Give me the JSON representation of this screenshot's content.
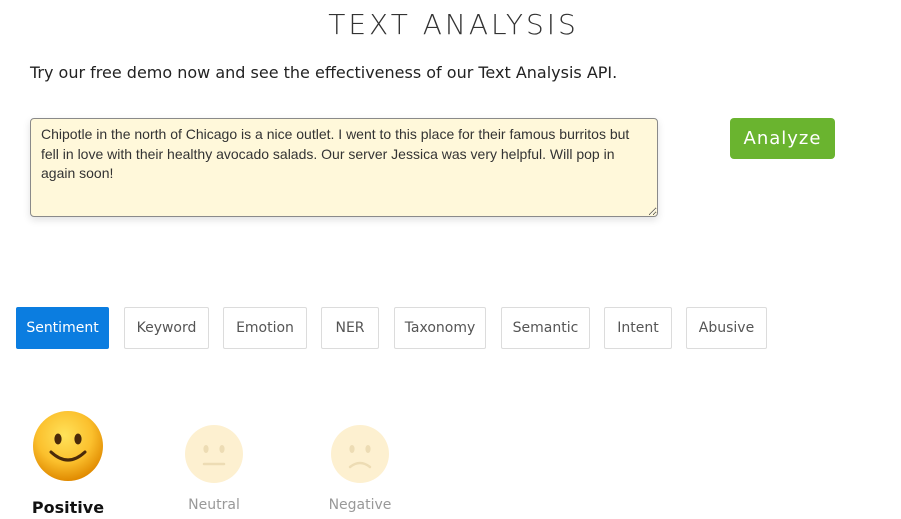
{
  "page": {
    "title": "TEXT ANALYSIS",
    "subtitle": "Try our free demo now and see the effectiveness of our Text Analysis API."
  },
  "input": {
    "text": "Chipotle in the north of Chicago is a nice outlet. I went to this place for their famous burritos but fell in love with their healthy avocado salads. Our server Jessica was very helpful. Will pop in again soon!"
  },
  "actions": {
    "analyze_label": "Analyze"
  },
  "tabs": [
    {
      "label": "Sentiment",
      "active": true
    },
    {
      "label": "Keyword",
      "active": false
    },
    {
      "label": "Emotion",
      "active": false
    },
    {
      "label": "NER",
      "active": false
    },
    {
      "label": "Taxonomy",
      "active": false
    },
    {
      "label": "Semantic",
      "active": false
    },
    {
      "label": "Intent",
      "active": false
    },
    {
      "label": "Abusive",
      "active": false
    }
  ],
  "result": {
    "sentiments": [
      {
        "label": "Positive",
        "icon": "smiling-face-icon",
        "selected": true
      },
      {
        "label": "Neutral",
        "icon": "neutral-face-icon",
        "selected": false
      },
      {
        "label": "Negative",
        "icon": "frowning-face-icon",
        "selected": false
      }
    ]
  },
  "colors": {
    "accent_green": "#6ab42f",
    "tab_active": "#0b7de0",
    "textarea_bg": "#fff8da"
  }
}
